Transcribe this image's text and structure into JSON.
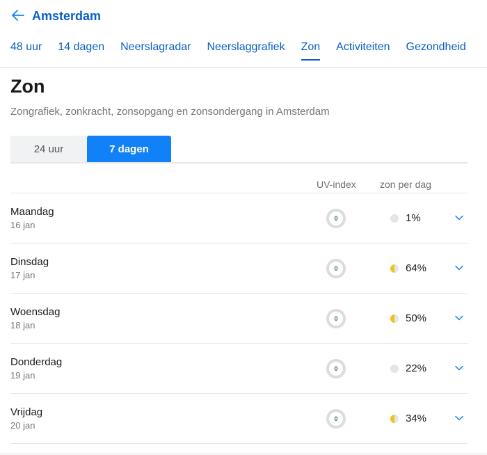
{
  "header": {
    "back_icon": "arrow-left-icon",
    "city": "Amsterdam",
    "tabs": [
      {
        "label": "48 uur"
      },
      {
        "label": "14 dagen"
      },
      {
        "label": "Neerslagradar"
      },
      {
        "label": "Neerslaggrafiek"
      },
      {
        "label": "Zon",
        "active": true
      },
      {
        "label": "Activiteiten"
      },
      {
        "label": "Gezondheid"
      }
    ]
  },
  "page": {
    "title": "Zon",
    "subtitle": "Zongrafiek, zonkracht, zonsopgang en zonsondergang in Amsterdam"
  },
  "segment": {
    "options": [
      "24 uur",
      "7 dagen"
    ],
    "selected": "7 dagen"
  },
  "columns": {
    "uv": "UV-index",
    "sun": "zon per dag"
  },
  "days": [
    {
      "day": "Maandag",
      "date": "16 jan",
      "uv": "0",
      "sun_pct": "1%",
      "sun_icon": "grey"
    },
    {
      "day": "Dinsdag",
      "date": "17 jan",
      "uv": "0",
      "sun_pct": "64%",
      "sun_icon": "half"
    },
    {
      "day": "Woensdag",
      "date": "18 jan",
      "uv": "0",
      "sun_pct": "50%",
      "sun_icon": "half"
    },
    {
      "day": "Donderdag",
      "date": "19 jan",
      "uv": "0",
      "sun_pct": "22%",
      "sun_icon": "grey"
    },
    {
      "day": "Vrijdag",
      "date": "20 jan",
      "uv": "0",
      "sun_pct": "34%",
      "sun_icon": "half"
    }
  ],
  "colors": {
    "accent": "#0b5fc6",
    "segment_active": "#1181f7",
    "sun_yellow": "#f2c21b",
    "uv_text": "#2e7d32"
  }
}
